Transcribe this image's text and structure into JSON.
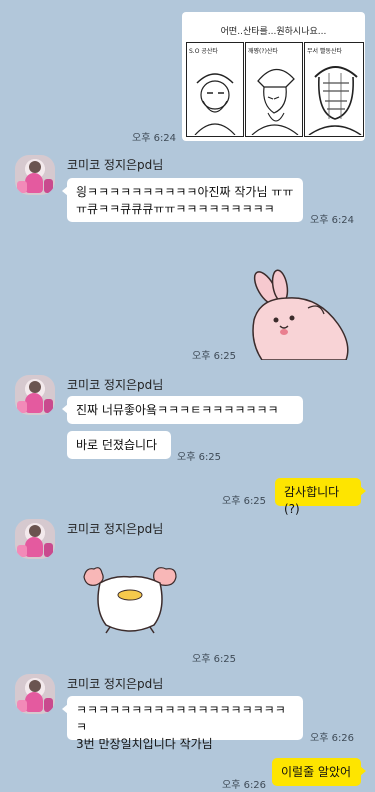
{
  "comic": {
    "title": "어떤..산타를...원하시나요...",
    "panel_labels": [
      "S.O 공산타",
      "깨쨩(?)산타",
      "무서 빨동산타"
    ],
    "time": "오후 6:24"
  },
  "sender_name": "코미코 정지은pd님",
  "messages": {
    "m1": {
      "text_line1": "읭ㅋㅋㅋㅋㅋㅋㅋㅋㅋㅋ아진짜 작가님 ㅠㅠ",
      "text_line2": "ㅠ큐ㅋㅋ큐큐큐ㅠㅠㅋㅋㅋㅋㅋㅋㅋㅋㅋ",
      "time": "오후 6:24"
    },
    "sticker_rabbit_time": "오후 6:25",
    "m2": {
      "text": "진짜 너뮤좋아욬ㅋㅋㅋㅌㅋㅋㅋㅋㅋㅋㅋ"
    },
    "m3": {
      "text": "바로 던졌습니다",
      "time": "오후 6:25"
    },
    "m4": {
      "text": "감사합니다(?)",
      "time": "오후 6:25"
    },
    "sticker_duck_time": "오후 6:25",
    "m5": {
      "text_line1": "ㅋㅋㅋㅋㅋㅋㅋㅋㅋㅋㅋㅋㅋㅋㅋㅋㅋㅋㅋㅋ",
      "text_line2": "3번 만장일치입니다 작가님",
      "time": "오후 6:26"
    },
    "m6": {
      "text": "이럴줄 알았어",
      "time": "오후 6:26"
    }
  },
  "colors": {
    "background": "#b2c7da",
    "my_bubble": "#fee500",
    "other_bubble": "#ffffff"
  }
}
